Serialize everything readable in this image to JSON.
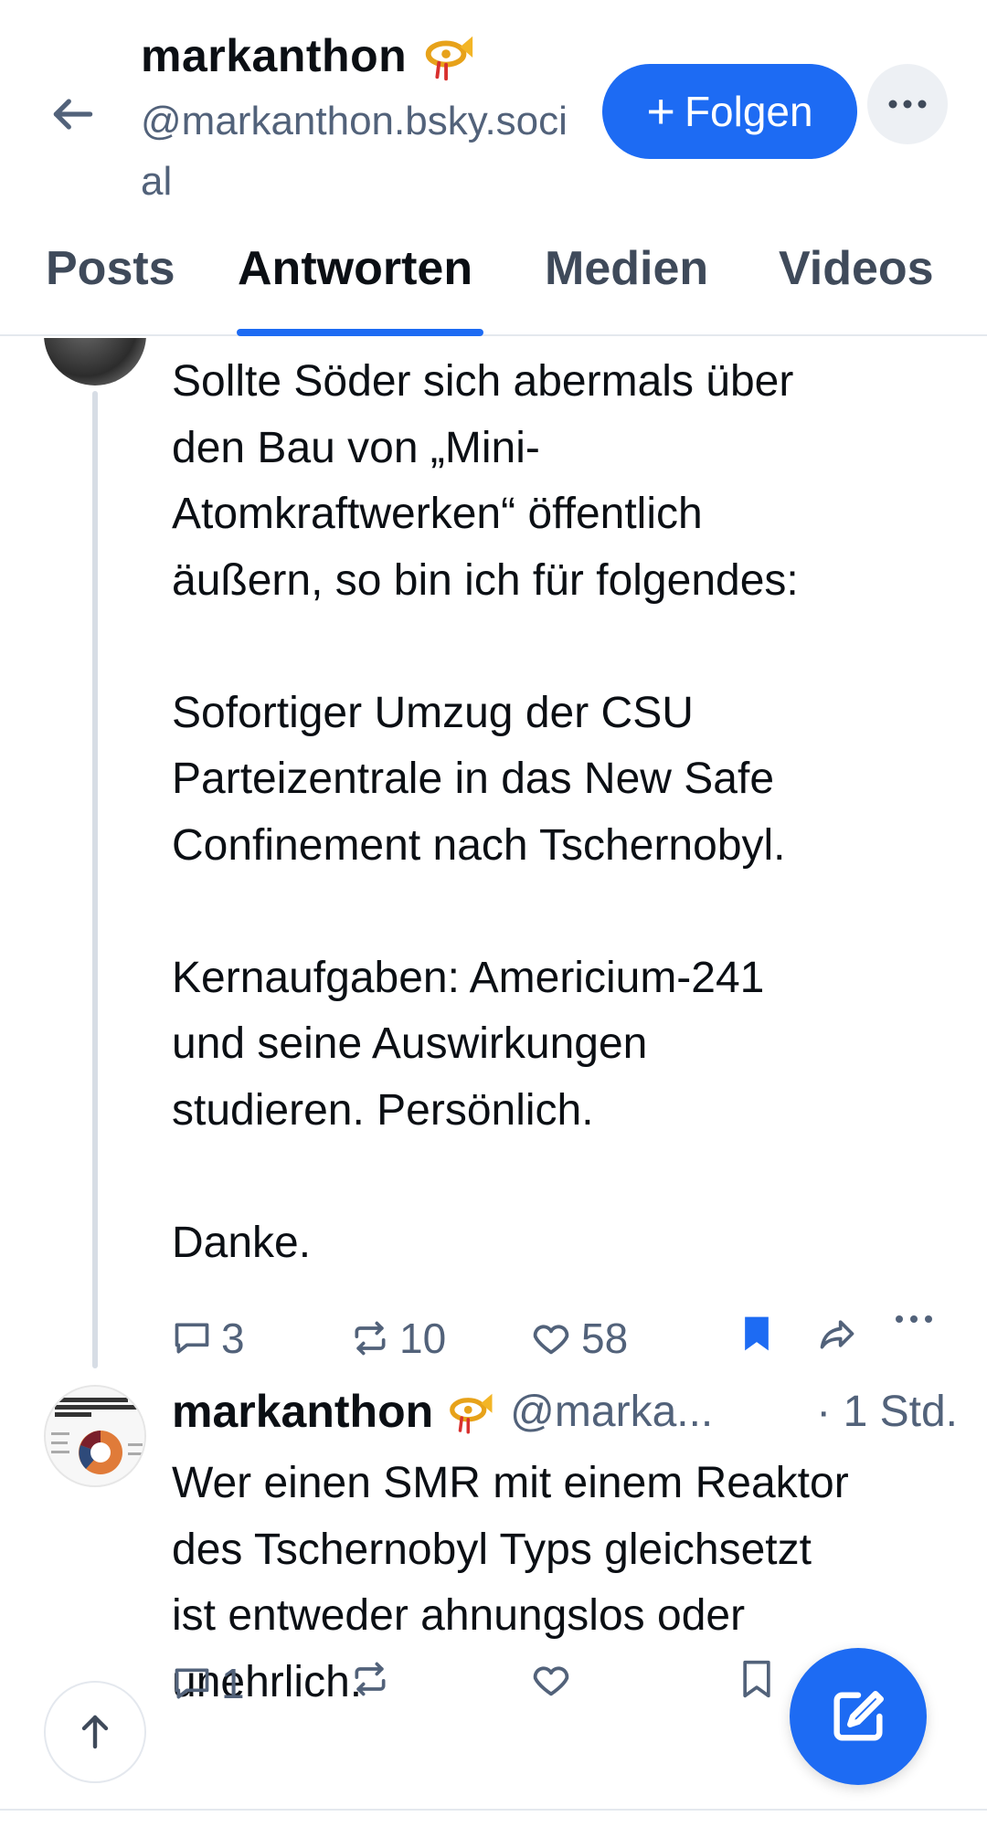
{
  "header": {
    "back_icon": "arrow-left-icon",
    "display_name": "markanthon",
    "name_emoji_icon": "postal-horn-icon",
    "handle": "@markanthon.bsky.social",
    "follow_label": "Folgen",
    "follow_plus": "+",
    "more_icon": "ellipsis-icon"
  },
  "tabs": [
    {
      "label": "Posts"
    },
    {
      "label": "Antworten"
    },
    {
      "label": "Medien"
    },
    {
      "label": "Videos"
    }
  ],
  "active_tab": "Antworten",
  "colors": {
    "accent": "#1d6bf3",
    "muted": "#52627a",
    "text": "#0b0f14"
  },
  "posts": [
    {
      "text": "Sollte Söder sich abermals über\nden Bau von „Mini-\nAtomkraftwerken“ öffentlich\näußern, so bin ich für folgendes:\n\nSofortiger Umzug der CSU\nParteizentrale in das New Safe\nConfinement nach Tschernobyl.\n\nKernaufgaben: Americium-241\nund seine Auswirkungen\nstudieren. Persönlich.\n\nDanke.",
      "replies": "3",
      "reposts": "10",
      "likes": "58",
      "bookmarked": true
    },
    {
      "author_name": "markanthon",
      "author_handle": "@marka...",
      "time": "· 1 Std.",
      "text": "Wer einen SMR mit einem Reaktor\ndes Tschernobyl Typs gleichsetzt\nist entweder ahnungslos oder\nunehrlich.",
      "replies": "1",
      "reposts": "",
      "likes": "",
      "bookmarked": false
    }
  ]
}
